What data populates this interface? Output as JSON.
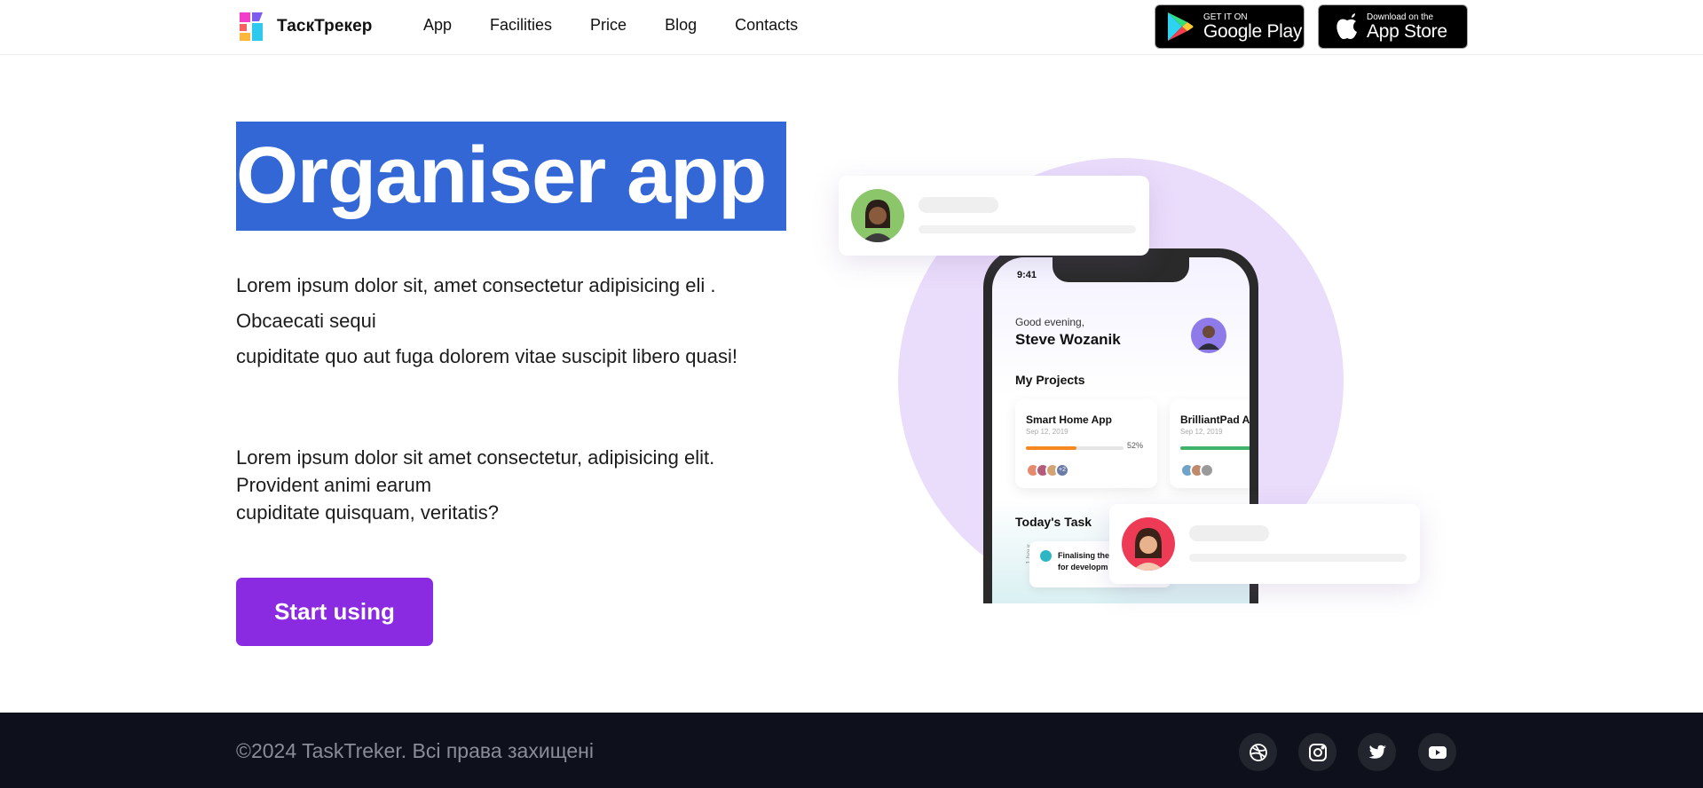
{
  "header": {
    "logo_text": "ТаскТрекер",
    "nav": [
      "App",
      "Facilities",
      "Price",
      "Blog",
      "Contacts"
    ],
    "google_play": {
      "small": "GET IT ON",
      "big": "Google Play"
    },
    "app_store": {
      "small": "Download on the",
      "big": "App Store"
    }
  },
  "hero": {
    "title": "Organiser app",
    "para1": [
      "Lorem ipsum dolor sit, amet consectetur adipisicing eli .",
      "Obcaecati sequi",
      "cupiditate quo aut fuga dolorem vitae suscipit libero quasi!"
    ],
    "para2": [
      "Lorem ipsum dolor sit amet consectetur, adipisicing elit.",
      "Provident animi earum",
      "cupiditate quisquam, veritatis?"
    ],
    "cta_label": "Start using"
  },
  "phone": {
    "time": "9:41",
    "greeting": "Good evening,",
    "user_name": "Steve Wozanik",
    "my_projects": "My Projects",
    "projects": [
      {
        "title": "Smart Home App",
        "date": "Sep 12, 2019",
        "percent": "52%",
        "progress": 0.52,
        "color": "#f5891f",
        "extra": "+2"
      },
      {
        "title": "BrilliantPad A",
        "date": "Sep 12, 2019",
        "progress": 0.8,
        "color": "#3fb36b"
      }
    ],
    "todays_task": "Today's Task",
    "task_text": [
      "Finalising the T",
      "for developm"
    ],
    "hour_label": "1 hour"
  },
  "footer": {
    "copyright": "©2024 TaskTreker. Всі права захищені",
    "social_icons": [
      "dribbble-icon",
      "instagram-icon",
      "twitter-icon",
      "youtube-icon"
    ]
  },
  "colors": {
    "accent_purple": "#8a2be2",
    "selection_blue": "#3367d6",
    "circle_lilac": "#eadcfb",
    "footer_bg": "#0e111b"
  }
}
